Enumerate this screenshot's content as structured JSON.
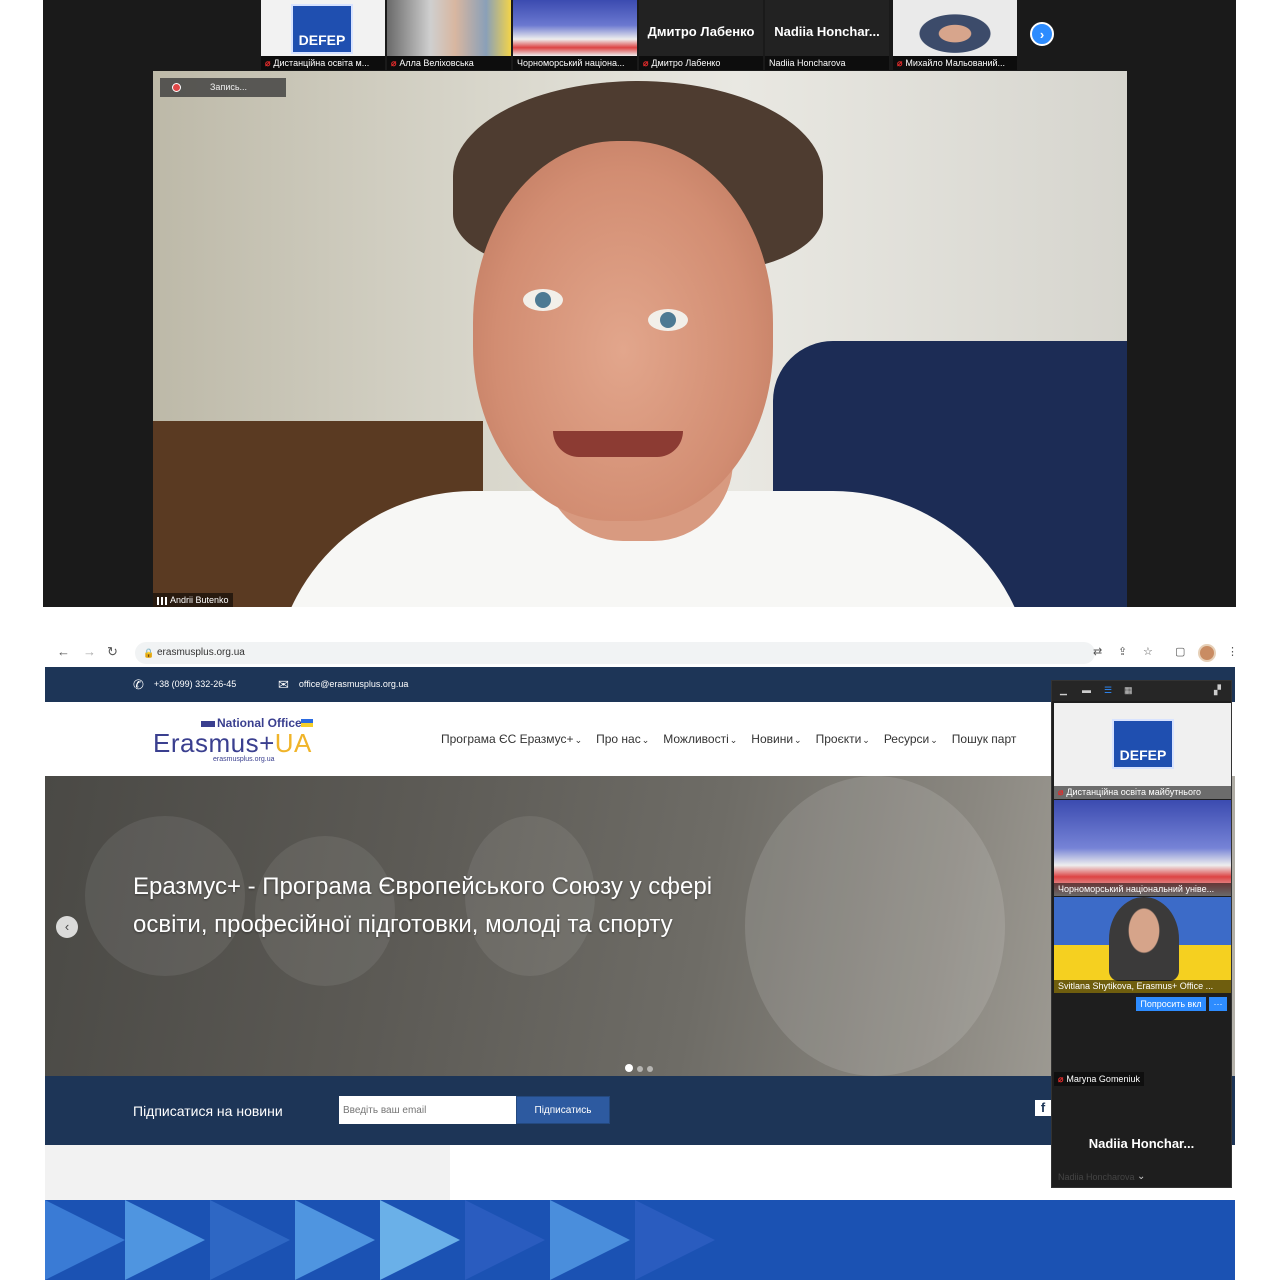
{
  "zoom_top": {
    "participants": [
      {
        "name": "Дистанційна освіта м...",
        "muted": true,
        "logo_text": "DEFEP"
      },
      {
        "name": "Алла Веліховська",
        "muted": true
      },
      {
        "name": "Чорноморський націона...",
        "muted": false
      },
      {
        "name": "Дмитро Лабенко",
        "muted": true,
        "big_label": "Дмитро Лабенко"
      },
      {
        "name": "Nadiia Honcharova",
        "muted": false,
        "big_label": "Nadiia Honchar..."
      },
      {
        "name": "Михайло Мальований...",
        "muted": true
      }
    ],
    "recording_label": "Запись...",
    "speaker_name": "Andrii Butenko"
  },
  "browser": {
    "url": "erasmusplus.org.ua"
  },
  "site": {
    "phone": "+38 (099) 332-26-45",
    "email": "office@erasmusplus.org.ua",
    "logo": {
      "top": "National Office",
      "main": "Erasmus+",
      "main_ua": "UA",
      "sub": "erasmusplus.org.ua"
    },
    "menu": [
      "Програма ЄС Еразмус+",
      "Про нас",
      "Можливості",
      "Новини",
      "Проєкти",
      "Ресурси",
      "Пошук парт"
    ],
    "hero_title": "Еразмус+ - Програма Європейського Союзу у сфері освіти, професійної підготовки, молоді та спорту",
    "subscribe_label": "Підписатися на новини",
    "email_placeholder": "Введіть ваш email",
    "subscribe_button": "Підписатись",
    "slider_count": 3,
    "slider_active": 1
  },
  "zoom_panel": {
    "tiles": [
      {
        "name": "Дистанційна освіта майбутнього",
        "muted": true,
        "logo_text": "DEFEP"
      },
      {
        "name": "Чорноморський національний уніве...",
        "muted": false
      },
      {
        "name": "Svitlana Shytikova, Erasmus+ Office ...",
        "muted": false
      }
    ],
    "ask_button": "Попросить вкл",
    "more_button": "···",
    "extra_participant": "Maryna Gomeniuk",
    "big_name": "Nadiia  Honchar...",
    "faded_name": "Nadiia Honcharova"
  },
  "colors": {
    "zoom_blue": "#2d8cff",
    "site_navy": "#1d3557",
    "erasmus_purple": "#3a3f8f",
    "chevron_blue": "#1b52b3"
  }
}
